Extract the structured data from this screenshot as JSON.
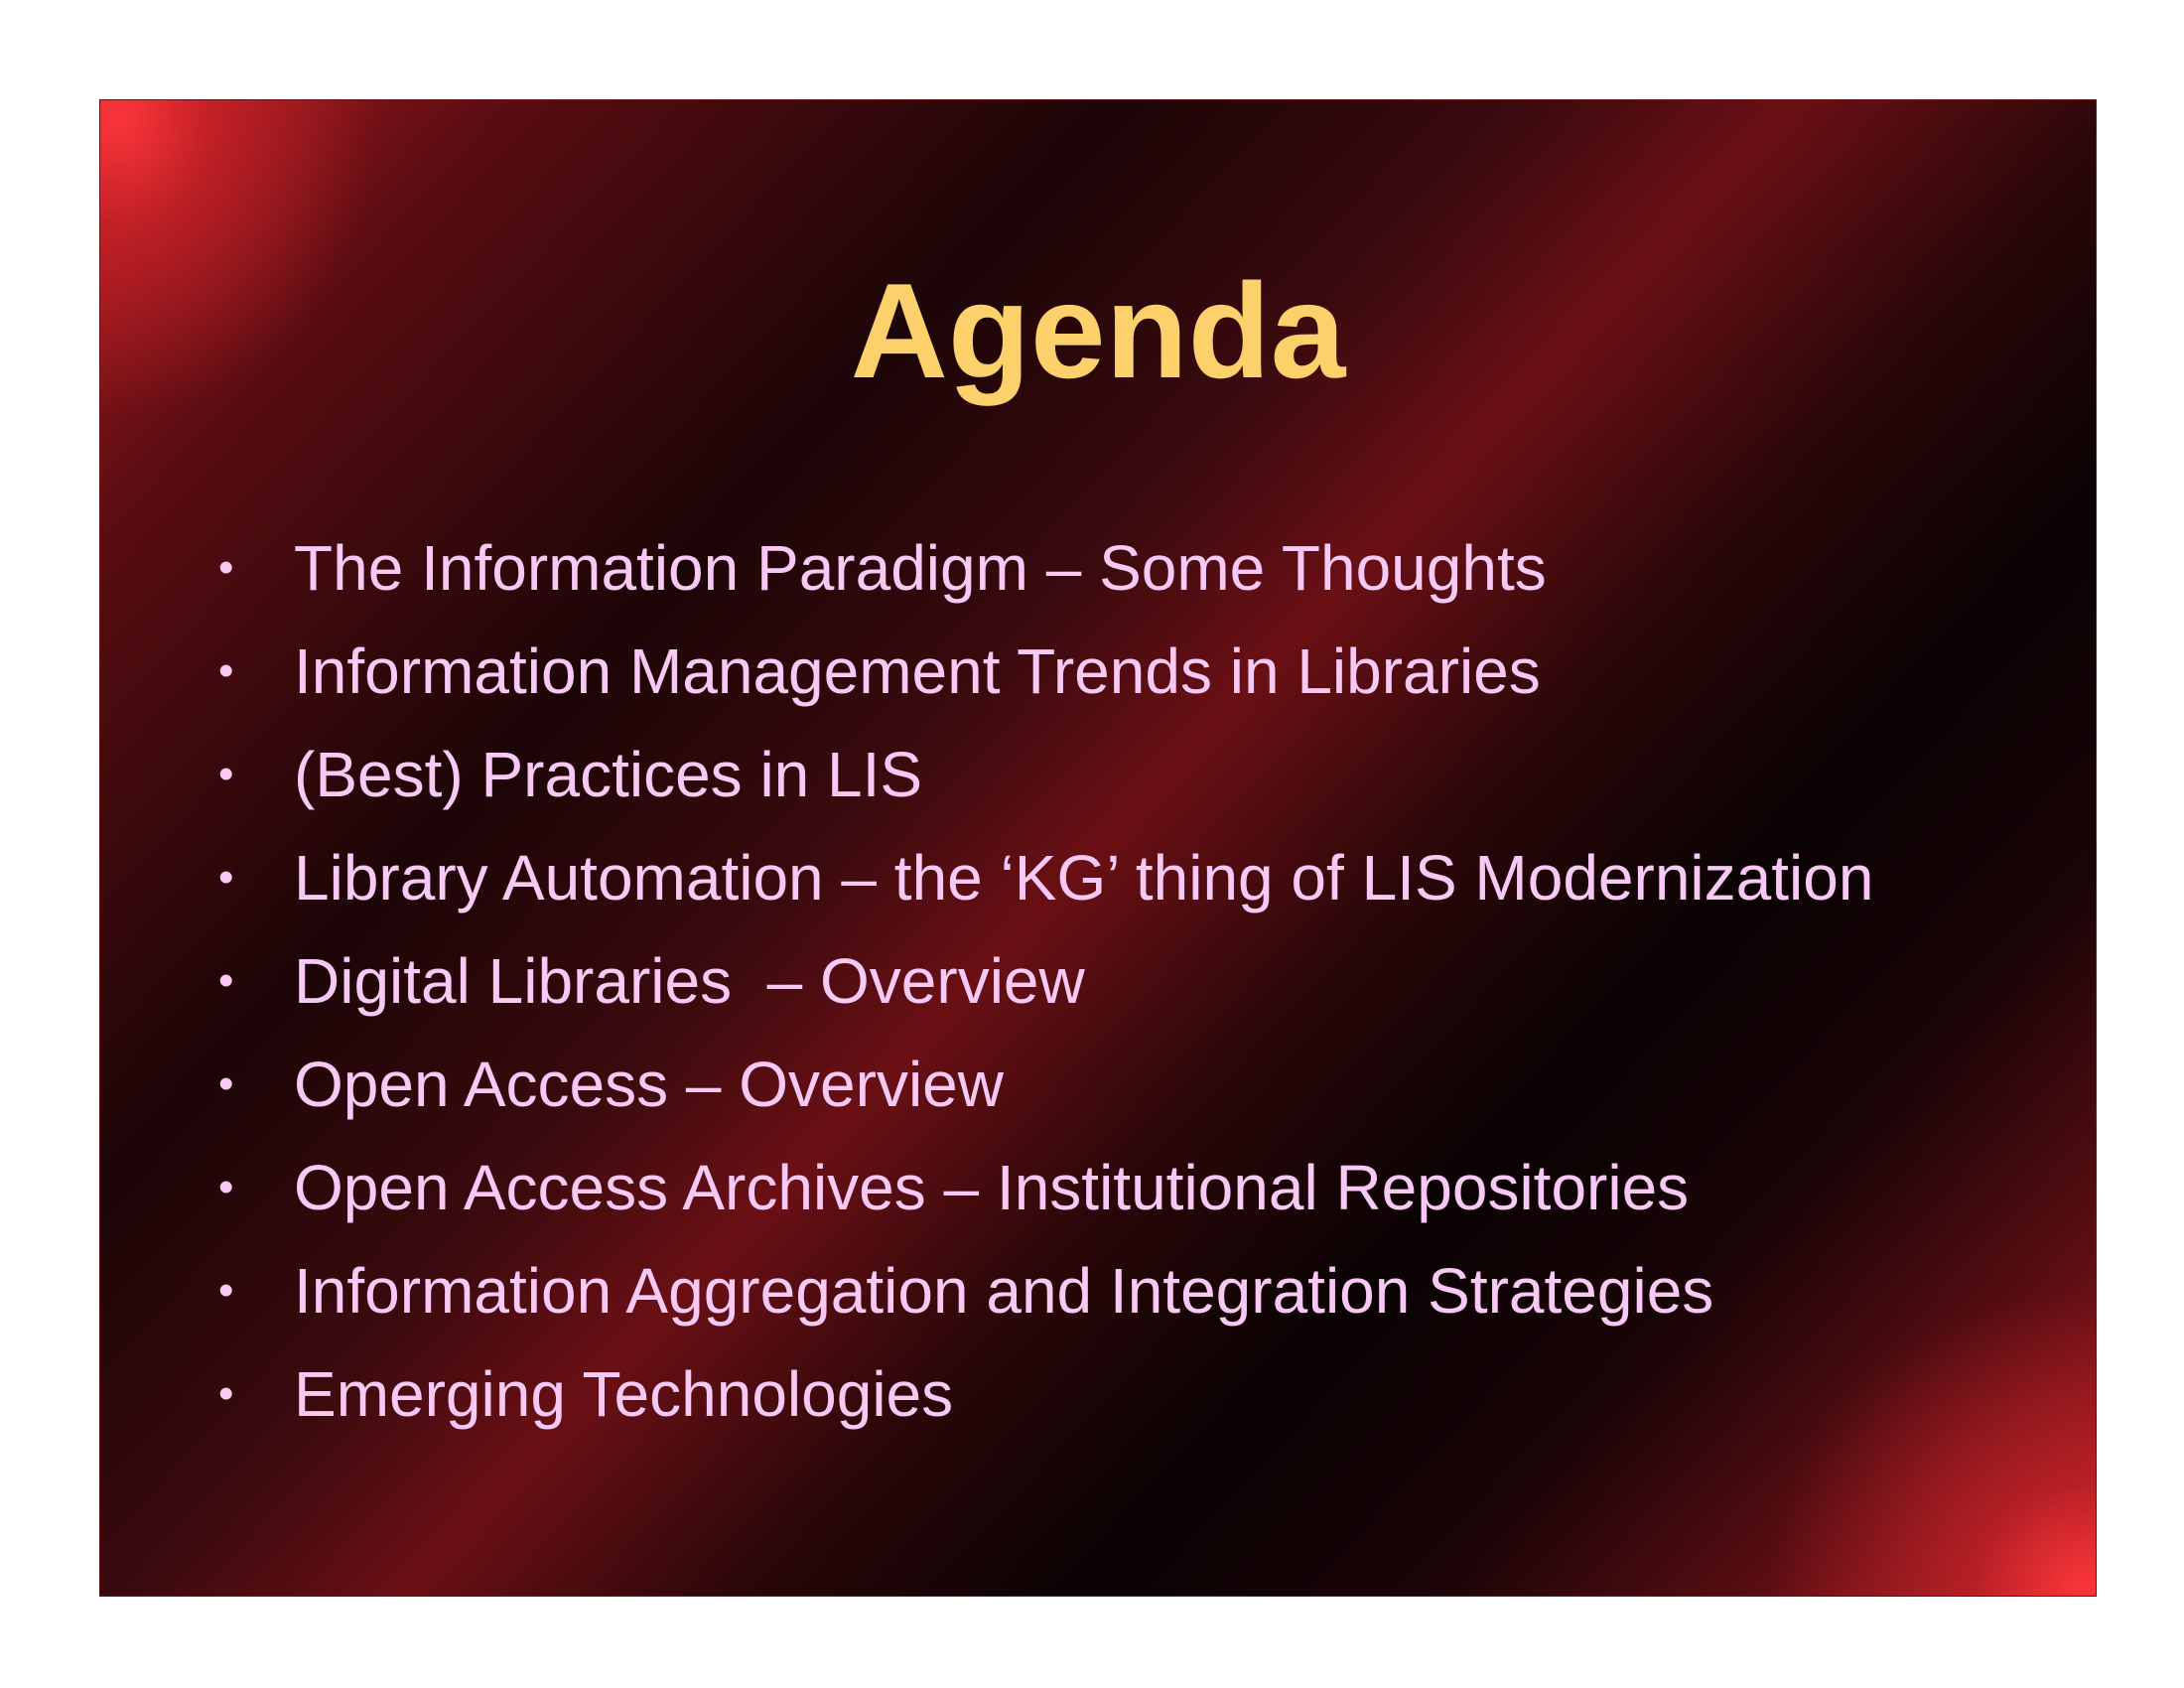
{
  "slide": {
    "title": "Agenda",
    "bullet_glyph": "•",
    "items": [
      "The Information Paradigm – Some Thoughts",
      "Information Management Trends in Libraries",
      "(Best) Practices in LIS",
      "Library Automation – the ‘KG’ thing of LIS Modernization",
      "Digital Libraries  – Overview",
      "Open Access – Overview",
      "Open Access Archives – Institutional Repositories",
      "Information Aggregation and Integration Strategies",
      "Emerging Technologies"
    ]
  },
  "colors": {
    "title": "#fcd06a",
    "text": "#f8c9f4",
    "background_dark": "#0a0203",
    "background_red": "#e02a30"
  }
}
